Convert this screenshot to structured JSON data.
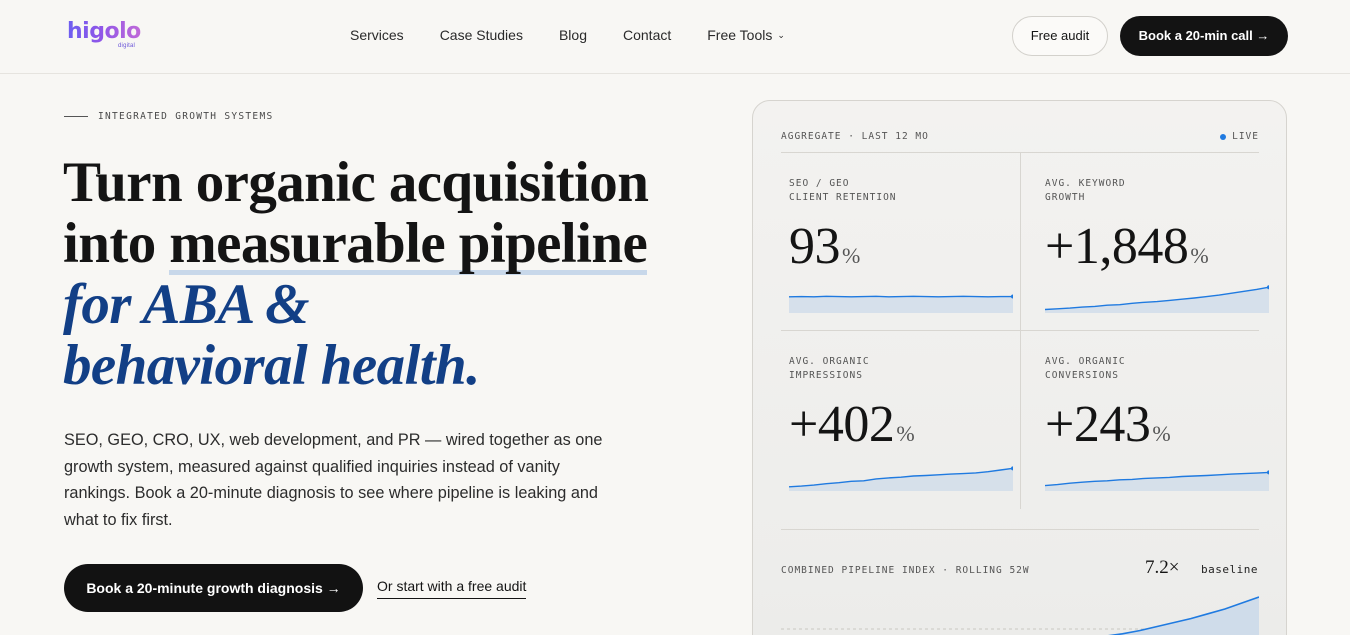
{
  "brand": {
    "name": "higolo",
    "sub": "digital"
  },
  "nav": {
    "links": [
      "Services",
      "Case Studies",
      "Blog",
      "Contact",
      "Free Tools"
    ],
    "free_audit": "Free audit",
    "book_call": "Book a 20-min call →"
  },
  "hero": {
    "eyebrow": "INTEGRATED GROWTH SYSTEMS",
    "headline": {
      "line1": "Turn organic acquisition",
      "line2_a": "into ",
      "line2_b": "measurable pipeline",
      "line3": "for ABA &",
      "line4": "behavioral health."
    },
    "description": "SEO, GEO, CRO, UX, web development, and PR — wired together as one growth system, measured against qualified inquiries instead of vanity rankings. Book a 20-minute diagnosis to see where pipeline is leaking and what to fix first.",
    "cta_primary": "Book a 20-minute growth diagnosis →",
    "cta_secondary": "Or start with a free audit"
  },
  "stats": {
    "header": "AGGREGATE · LAST 12 MO",
    "live": "LIVE",
    "accent": "#1f7ae0",
    "cells": [
      {
        "label": "SEO / GEO\nCLIENT RETENTION",
        "value": "93",
        "unit": "%",
        "trend": [
          0.55,
          0.56,
          0.55,
          0.57,
          0.56,
          0.55,
          0.56,
          0.57,
          0.55,
          0.56,
          0.57,
          0.56,
          0.55,
          0.56,
          0.57,
          0.56,
          0.55,
          0.56,
          0.56
        ]
      },
      {
        "label": "AVG. KEYWORD\nGROWTH",
        "value": "+1,848",
        "unit": "%",
        "trend": [
          0.02,
          0.05,
          0.08,
          0.12,
          0.15,
          0.2,
          0.22,
          0.28,
          0.32,
          0.35,
          0.4,
          0.45,
          0.5,
          0.56,
          0.62,
          0.7,
          0.78,
          0.86,
          0.95
        ]
      },
      {
        "label": "AVG. ORGANIC\nIMPRESSIONS",
        "value": "+402",
        "unit": "%",
        "trend": [
          0.05,
          0.08,
          0.12,
          0.18,
          0.22,
          0.28,
          0.3,
          0.38,
          0.42,
          0.45,
          0.5,
          0.52,
          0.55,
          0.58,
          0.6,
          0.63,
          0.68,
          0.75,
          0.82
        ]
      },
      {
        "label": "AVG. ORGANIC\nCONVERSIONS",
        "value": "+243",
        "unit": "%",
        "trend": [
          0.1,
          0.14,
          0.2,
          0.24,
          0.28,
          0.3,
          0.34,
          0.36,
          0.4,
          0.42,
          0.44,
          0.48,
          0.5,
          0.52,
          0.55,
          0.58,
          0.6,
          0.62,
          0.65
        ]
      }
    ],
    "pipeline": {
      "label": "COMBINED PIPELINE INDEX · ROLLING 52W",
      "multiplier": "7.2×",
      "baseline": "baseline",
      "trend": [
        0.0,
        0.0,
        0.0,
        0.0,
        0.0,
        0.0,
        0.0,
        0.0,
        0.0,
        0.0,
        0.0,
        0.0,
        0.0,
        0.0,
        0.0,
        0.0,
        0.0,
        0.0,
        0.0,
        0.02,
        0.08,
        0.16,
        0.26,
        0.36,
        0.46,
        0.58,
        0.7,
        0.85,
        1.0
      ]
    }
  }
}
